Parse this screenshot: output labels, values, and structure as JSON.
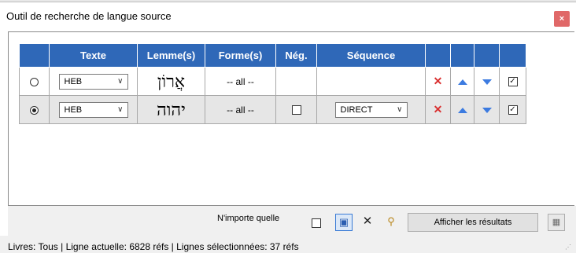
{
  "window": {
    "title": "Outil de recherche de langue source",
    "close_label": "×"
  },
  "columns": [
    "",
    "Texte",
    "Lemme(s)",
    "Forme(s)",
    "Nég.",
    "Séquence",
    "",
    "",
    "",
    ""
  ],
  "rows": [
    {
      "selected": false,
      "text": "HEB",
      "lemma": "אֲרוֹן",
      "forms": "-- all --",
      "negation_visible": false,
      "negated": false,
      "sequence": "",
      "enabled": true
    },
    {
      "selected": true,
      "text": "HEB",
      "lemma": "יהוה",
      "forms": "-- all --",
      "negation_visible": true,
      "negated": false,
      "sequence": "DIRECT",
      "enabled": true
    }
  ],
  "toolbar": {
    "any_label": "N'importe quelle",
    "any_checked": false,
    "show_results_label": "Afficher les résultats"
  },
  "status": {
    "text": "Livres: Tous | Ligne actuelle: 6828 réfs | Lignes sélectionnées: 37 réfs"
  },
  "colors": {
    "header_bg": "#2f68b8",
    "close_bg": "#e06868",
    "delete_icon": "#d93030",
    "arrow_icon": "#3c7be0"
  },
  "icons": {
    "close": "close-icon",
    "delete": "delete-x-icon",
    "move_up": "arrow-up-icon",
    "move_down": "arrow-down-icon",
    "book_search": "book-search-icon",
    "clear": "clear-x-icon",
    "find": "binoculars-icon",
    "export": "export-icon"
  }
}
